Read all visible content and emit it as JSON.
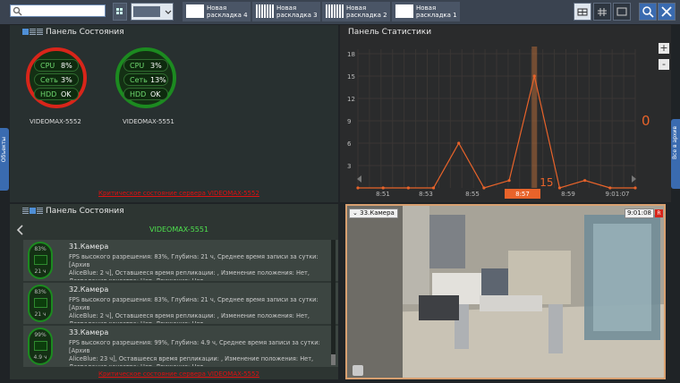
{
  "toolbar": {
    "search_placeholder": "",
    "layout_tabs": [
      {
        "label": "Новая раскладка 4"
      },
      {
        "label": "Новая раскладка 3"
      },
      {
        "label": "Новая раскладка 2"
      },
      {
        "label": "Новая раскладка 1"
      }
    ]
  },
  "status_panel_top": {
    "title": "Панель Состояния",
    "servers": [
      {
        "name": "VIDEOMAX-5552",
        "status_color": "#d8251a",
        "rows": [
          {
            "key": "CPU",
            "value": "8%"
          },
          {
            "key": "Сеть",
            "value": "3%"
          },
          {
            "key": "HDD",
            "value": "OK"
          }
        ]
      },
      {
        "name": "VIDEOMAX-5551",
        "status_color": "#1c8a20",
        "rows": [
          {
            "key": "CPU",
            "value": "3%"
          },
          {
            "key": "Сеть",
            "value": "13%"
          },
          {
            "key": "HDD",
            "value": "OK"
          }
        ]
      }
    ],
    "critical_text": "Критическое состояние сервера VIDEOMAX-5552"
  },
  "stats_panel": {
    "title": "Панель Статистики",
    "current_value": "0",
    "marker_value": "15",
    "chart_data": {
      "type": "line",
      "x": [
        "8:50",
        "8:51",
        "8:52",
        "8:53",
        "8:54",
        "8:55",
        "8:56",
        "8:57",
        "8:58",
        "8:59",
        "9:00",
        "9:01"
      ],
      "values": [
        0,
        0,
        0,
        0,
        6,
        0,
        1,
        15,
        0,
        1,
        0,
        0
      ],
      "ylim": [
        0,
        18
      ],
      "y_ticks": [
        "18",
        "15",
        "12",
        "9",
        "6",
        "3"
      ],
      "x_tick_labels": [
        "8:51",
        "8:53",
        "8:55",
        "8:57",
        "8:59",
        "9:01:07"
      ],
      "highlight": "8:57",
      "grid": true,
      "line_color": "#e8632a"
    }
  },
  "status_panel_bottom": {
    "title": "Панель Состояния",
    "server_name": "VIDEOMAX-5551",
    "cameras": [
      {
        "name": "31.Камера",
        "top": "83%",
        "bottom": "21 ч",
        "desc": "FPS высокого разрешения: 83%, Глубина: 21 ч, Среднее время записи за сутки: [Архив\nAliceBlue: 2 ч], Оставшееся время репликации: , Изменение положения: Нет,\nДеградация качества: Нет, Движение: Нет"
      },
      {
        "name": "32.Камера",
        "top": "83%",
        "bottom": "21 ч",
        "desc": "FPS высокого разрешения: 83%, Глубина: 21 ч, Среднее время записи за сутки: [Архив\nAliceBlue: 2 ч], Оставшееся время репликации: , Изменение положения: Нет,\nДеградация качества: Нет, Движение: Нет"
      },
      {
        "name": "33.Камера",
        "top": "99%",
        "bottom": "4.9 ч",
        "desc": "FPS высокого разрешения: 99%, Глубина: 4.9 ч, Среднее время записи за сутки: [Архив\nAliceBlue: 23 ч], Оставшееся время репликации: , Изменение положения: Нет,\nДеградация качества: Нет, Движение: Нет"
      }
    ],
    "critical_text": "Критическое состояние сервера VIDEOMAX-5552"
  },
  "camera_view": {
    "name": "33.Камера",
    "time": "9:01:08",
    "rec_indicator": "R"
  },
  "sidebar_left_label": "Объекты",
  "sidebar_right_label": "Все в архив",
  "zoom_in_label": "+",
  "zoom_out_label": "-"
}
